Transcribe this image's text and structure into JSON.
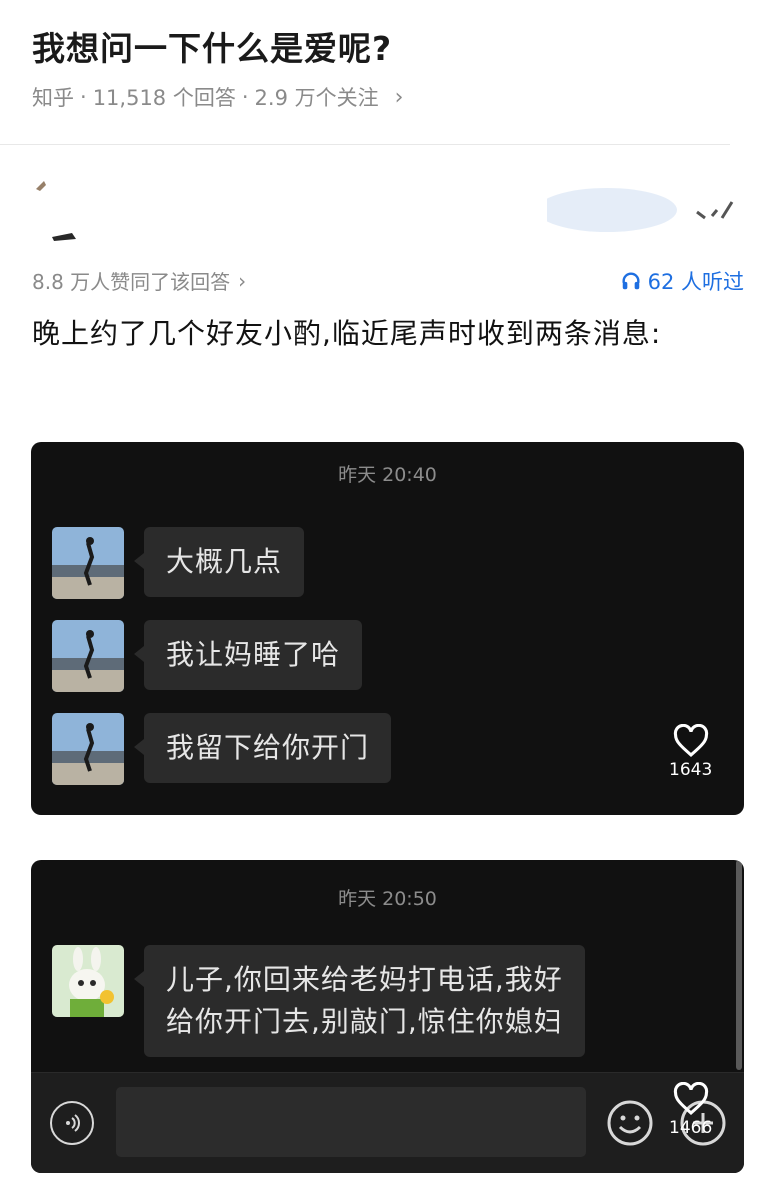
{
  "question": {
    "title": "我想问一下什么是爱呢?",
    "source": "知乎",
    "answers": "11,518 个回答",
    "followers": "2.9 万个关注",
    "separator": "·"
  },
  "answer": {
    "votes_text": "8.8 万人赞同了该回答",
    "listen_text": "62 人听过",
    "body": "晚上约了几个好友小酌,临近尾声时收到两条消息:"
  },
  "chat1": {
    "timestamp": "昨天 20:40",
    "messages": [
      {
        "text": "大概几点"
      },
      {
        "text": "我让妈睡了哈"
      },
      {
        "text": "我留下给你开门"
      }
    ],
    "likes": "1643"
  },
  "chat2": {
    "timestamp": "昨天 20:50",
    "messages": [
      {
        "line1": "儿子,你回来给老妈打电话,我好",
        "line2": "给你开门去,别敲门,惊住你媳妇"
      }
    ],
    "likes": "1466"
  },
  "icons": {
    "listen": "headphones-icon",
    "heart": "heart-icon",
    "voice": "voice-icon",
    "emoji": "emoji-icon",
    "plus": "plus-icon"
  },
  "colors": {
    "accent_blue": "#1e6fe1",
    "chat_bg": "#111111",
    "bubble_bg": "#2b2b2b",
    "meta_gray": "#8a8a8a"
  }
}
